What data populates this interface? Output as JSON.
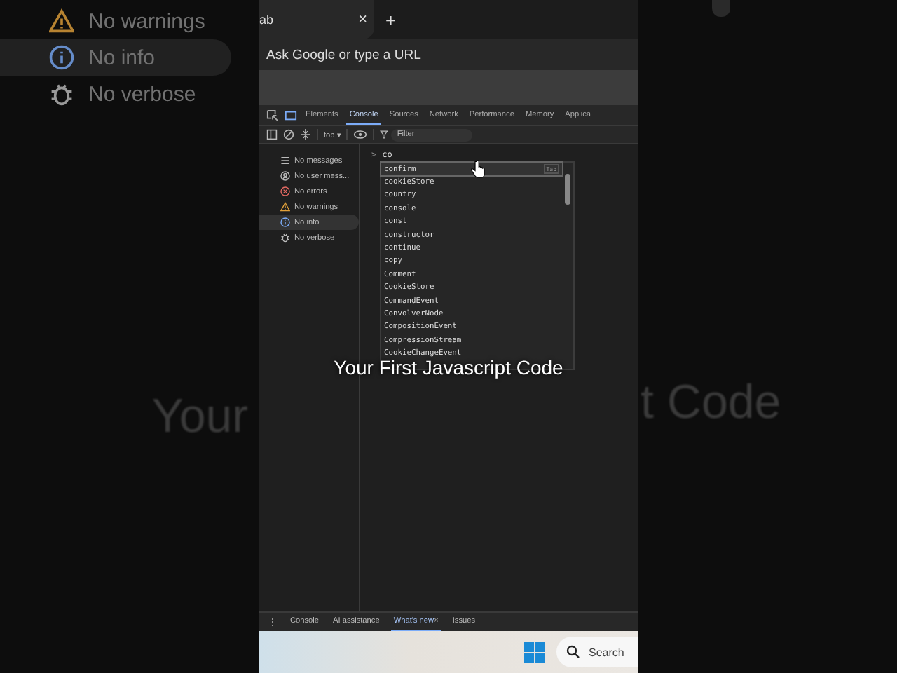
{
  "background": {
    "sidebar_items": [
      {
        "label": "No warnings",
        "kind": "warning",
        "selected": false
      },
      {
        "label": "No info",
        "kind": "info",
        "selected": true
      },
      {
        "label": "No verbose",
        "kind": "verbose",
        "selected": false
      }
    ],
    "title_left": "Your",
    "title_right": "t Code"
  },
  "browser": {
    "tab": {
      "title": "ab",
      "close": "×"
    },
    "new_tab": "+",
    "address_bar": {
      "placeholder": "Ask Google or type a URL"
    }
  },
  "devtools": {
    "tabs": [
      {
        "label": "Elements",
        "selected": false
      },
      {
        "label": "Console",
        "selected": true
      },
      {
        "label": "Sources",
        "selected": false
      },
      {
        "label": "Network",
        "selected": false
      },
      {
        "label": "Performance",
        "selected": false
      },
      {
        "label": "Memory",
        "selected": false
      },
      {
        "label": "Applica",
        "selected": false
      }
    ],
    "toolbar": {
      "context": "top",
      "context_caret": "▾",
      "filter": {
        "placeholder": "Filter"
      }
    },
    "sidebar": {
      "items": [
        {
          "label": "No messages",
          "kind": "list",
          "selected": false
        },
        {
          "label": "No user mess...",
          "kind": "user",
          "selected": false
        },
        {
          "label": "No errors",
          "kind": "error",
          "selected": false
        },
        {
          "label": "No warnings",
          "kind": "warning",
          "selected": false
        },
        {
          "label": "No info",
          "kind": "info",
          "selected": true
        },
        {
          "label": "No verbose",
          "kind": "verbose",
          "selected": false
        }
      ]
    },
    "console": {
      "prompt": ">",
      "input": "co",
      "autocomplete": {
        "hint": "Tab",
        "items": [
          {
            "label": "confirm",
            "selected": true
          },
          {
            "label": "cookieStore",
            "selected": false
          },
          {
            "label": "country",
            "selected": false
          },
          {
            "label": "console",
            "selected": false
          },
          {
            "label": "const",
            "selected": false
          },
          {
            "label": "constructor",
            "selected": false
          },
          {
            "label": "continue",
            "selected": false
          },
          {
            "label": "copy",
            "selected": false
          },
          {
            "label": "Comment",
            "selected": false
          },
          {
            "label": "CookieStore",
            "selected": false
          },
          {
            "label": "CommandEvent",
            "selected": false
          },
          {
            "label": "ConvolverNode",
            "selected": false
          },
          {
            "label": "CompositionEvent",
            "selected": false
          },
          {
            "label": "CompressionStream",
            "selected": false
          },
          {
            "label": "CookieChangeEvent",
            "selected": false
          }
        ]
      }
    },
    "drawer_more": "⋮",
    "drawer_tabs": [
      {
        "label": "Console",
        "selected": false
      },
      {
        "label": "AI assistance",
        "selected": false
      },
      {
        "label": "What's new",
        "selected": true,
        "close": "×"
      },
      {
        "label": "Issues",
        "selected": false
      }
    ]
  },
  "caption": "Your First Javascript Code",
  "taskbar": {
    "search": {
      "placeholder": "Search"
    }
  }
}
